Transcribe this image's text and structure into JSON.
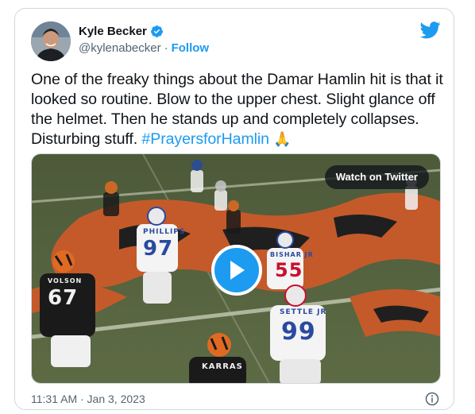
{
  "author": {
    "name": "Kyle Becker",
    "handle": "@kylenabecker",
    "separator": "·",
    "follow_label": "Follow",
    "verified_color": "#1d9bf0",
    "avatar_icon": "profile-photo"
  },
  "tweet": {
    "text_plain": "One of the freaky things about the Damar Hamlin hit is that it looked so routine. Blow to the upper chest. Slight glance off the helmet. Then he stands up and completely collapses. Disturbing stuff. ",
    "hashtag": "#PrayersforHamlin",
    "emoji": "🙏",
    "link_color": "#1d9bf0"
  },
  "media": {
    "watch_label": "Watch on Twitter",
    "play_icon": "play-icon",
    "jerseys": {
      "player_97": "97",
      "player_97_name": "PHILLIPS",
      "player_55": "55",
      "player_55_name": "BISHAR JR",
      "player_99": "99",
      "player_99_name": "SETTLE JR",
      "player_67": "67",
      "player_67_name": "VOLSON",
      "player_64_name": "KARRAS"
    }
  },
  "footer": {
    "timestamp": "11:31 AM · Jan 3, 2023",
    "info_icon": "info-icon"
  },
  "brand": {
    "twitter_blue": "#1d9bf0"
  }
}
